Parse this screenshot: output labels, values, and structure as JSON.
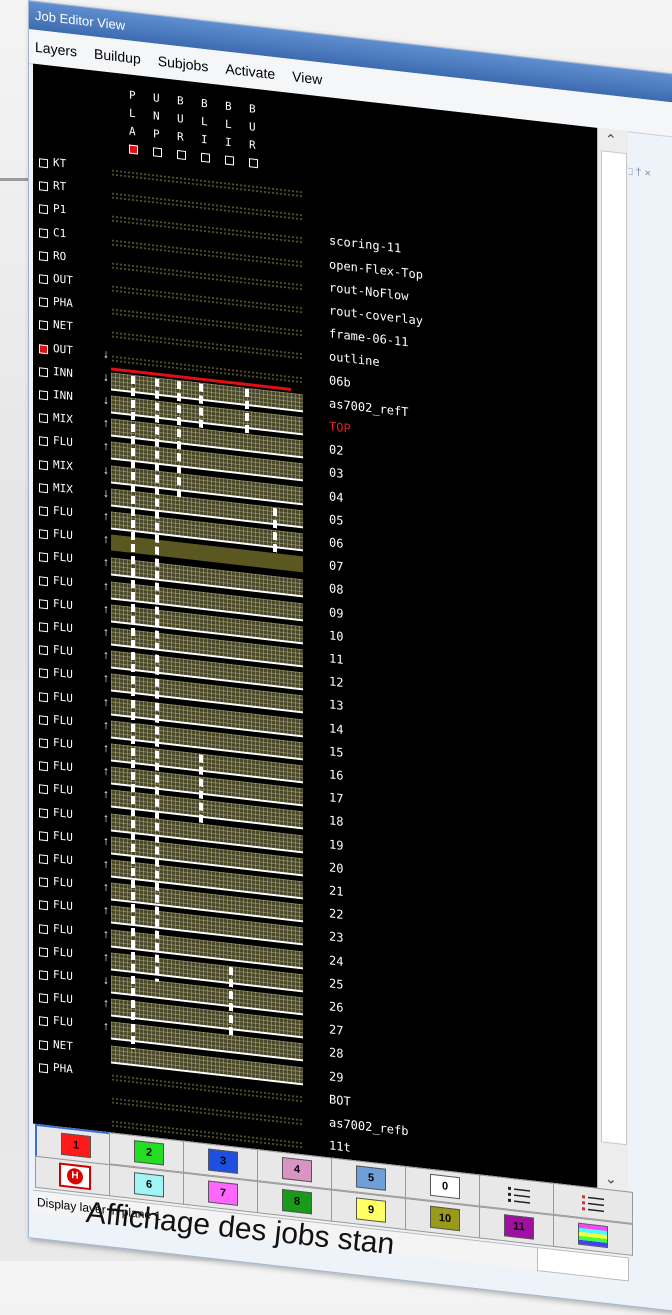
{
  "window": {
    "title": "Job Editor View",
    "controls": "□ † ×"
  },
  "menu": [
    "Layers",
    "Buildup",
    "Subjobs",
    "Activate",
    "View"
  ],
  "header_columns": [
    {
      "letters": [
        "P",
        "L",
        "A"
      ],
      "checked": true
    },
    {
      "letters": [
        "U",
        "N",
        "P"
      ],
      "checked": false
    },
    {
      "letters": [
        "B",
        "U",
        "R"
      ],
      "checked": false
    },
    {
      "letters": [
        "B",
        "L",
        "I"
      ],
      "checked": false
    },
    {
      "letters": [
        "B",
        "L",
        "I"
      ],
      "checked": false
    },
    {
      "letters": [
        "B",
        "U",
        "R"
      ],
      "checked": false
    }
  ],
  "layers": [
    {
      "type": "KT",
      "name": "",
      "checked": false,
      "arrow": "",
      "band": "dots"
    },
    {
      "type": "RT",
      "name": "",
      "checked": false,
      "arrow": "",
      "band": "dots"
    },
    {
      "type": "P1",
      "name": "scoring-11",
      "checked": false,
      "arrow": "",
      "band": "dots"
    },
    {
      "type": "C1",
      "name": "open-Flex-Top",
      "checked": false,
      "arrow": "",
      "band": "dots"
    },
    {
      "type": "RO",
      "name": "rout-NoFlow",
      "checked": false,
      "arrow": "",
      "band": "dots"
    },
    {
      "type": "OUT",
      "name": "rout-coverlay",
      "checked": false,
      "arrow": "",
      "band": "dots"
    },
    {
      "type": "PHA",
      "name": "frame-06-11",
      "checked": false,
      "arrow": "",
      "band": "dots"
    },
    {
      "type": "NET",
      "name": "outline",
      "checked": false,
      "arrow": "",
      "band": "dots"
    },
    {
      "type": "OUT",
      "name": "06b",
      "checked": true,
      "arrow": "↓",
      "band": "dots"
    },
    {
      "type": "INN",
      "name": "as7002_refT",
      "checked": false,
      "arrow": "↓",
      "band": "cu"
    },
    {
      "type": "INN",
      "name": "TOP",
      "checked": false,
      "arrow": "↓",
      "band": "cu",
      "red": true
    },
    {
      "type": "MIX",
      "name": "02",
      "checked": false,
      "arrow": "↑",
      "band": "cu"
    },
    {
      "type": "FLU",
      "name": "03",
      "checked": false,
      "arrow": "↑",
      "band": "cu"
    },
    {
      "type": "MIX",
      "name": "04",
      "checked": false,
      "arrow": "↓",
      "band": "cu"
    },
    {
      "type": "MIX",
      "name": "05",
      "checked": false,
      "arrow": "↓",
      "band": "cu"
    },
    {
      "type": "FLU",
      "name": "06",
      "checked": false,
      "arrow": "↑",
      "band": "cu"
    },
    {
      "type": "FLU",
      "name": "07",
      "checked": false,
      "arrow": "↑",
      "band": "yellow"
    },
    {
      "type": "FLU",
      "name": "08",
      "checked": false,
      "arrow": "↑",
      "band": "cu"
    },
    {
      "type": "FLU",
      "name": "09",
      "checked": false,
      "arrow": "↑",
      "band": "cu"
    },
    {
      "type": "FLU",
      "name": "10",
      "checked": false,
      "arrow": "↑",
      "band": "cu"
    },
    {
      "type": "FLU",
      "name": "11",
      "checked": false,
      "arrow": "↑",
      "band": "cu"
    },
    {
      "type": "FLU",
      "name": "12",
      "checked": false,
      "arrow": "↑",
      "band": "cu"
    },
    {
      "type": "FLU",
      "name": "13",
      "checked": false,
      "arrow": "↑",
      "band": "cu"
    },
    {
      "type": "FLU",
      "name": "14",
      "checked": false,
      "arrow": "↑",
      "band": "cu"
    },
    {
      "type": "FLU",
      "name": "15",
      "checked": false,
      "arrow": "↑",
      "band": "cu"
    },
    {
      "type": "FLU",
      "name": "16",
      "checked": false,
      "arrow": "↑",
      "band": "cu"
    },
    {
      "type": "FLU",
      "name": "17",
      "checked": false,
      "arrow": "↑",
      "band": "cu"
    },
    {
      "type": "FLU",
      "name": "18",
      "checked": false,
      "arrow": "↑",
      "band": "cu"
    },
    {
      "type": "FLU",
      "name": "19",
      "checked": false,
      "arrow": "↑",
      "band": "cu"
    },
    {
      "type": "FLU",
      "name": "20",
      "checked": false,
      "arrow": "↑",
      "band": "cu"
    },
    {
      "type": "FLU",
      "name": "21",
      "checked": false,
      "arrow": "↑",
      "band": "cu"
    },
    {
      "type": "FLU",
      "name": "22",
      "checked": false,
      "arrow": "↑",
      "band": "cu"
    },
    {
      "type": "FLU",
      "name": "23",
      "checked": false,
      "arrow": "↑",
      "band": "cu"
    },
    {
      "type": "FLU",
      "name": "24",
      "checked": false,
      "arrow": "↑",
      "band": "cu"
    },
    {
      "type": "FLU",
      "name": "25",
      "checked": false,
      "arrow": "↑",
      "band": "cu"
    },
    {
      "type": "FLU",
      "name": "26",
      "checked": false,
      "arrow": "↓",
      "band": "cu"
    },
    {
      "type": "FLU",
      "name": "27",
      "checked": false,
      "arrow": "↑",
      "band": "cu"
    },
    {
      "type": "FLU",
      "name": "28",
      "checked": false,
      "arrow": "↑",
      "band": "cu"
    },
    {
      "type": "NET",
      "name": "29",
      "checked": false,
      "arrow": "",
      "band": "cu"
    },
    {
      "type": "PHA",
      "name": "BOT",
      "checked": false,
      "arrow": "",
      "band": "dots"
    },
    {
      "type": "",
      "name": "as7002_refb",
      "checked": false,
      "arrow": "",
      "band": "dots"
    },
    {
      "type": "",
      "name": "11t",
      "checked": false,
      "arrow": "",
      "band": "dots"
    }
  ],
  "palette_top": [
    {
      "label": "1",
      "color": "#ff1a1a",
      "selected": true
    },
    {
      "label": "2",
      "color": "#22dd22"
    },
    {
      "label": "3",
      "color": "#1f4fe0"
    },
    {
      "label": "4",
      "color": "#d994c4"
    },
    {
      "label": "5",
      "color": "#6f9fd8"
    },
    {
      "label": "0",
      "color": "#ffffff"
    },
    {
      "label": "",
      "color": "list-icon"
    },
    {
      "label": "",
      "color": "colored-list-icon"
    }
  ],
  "palette_bottom": [
    {
      "label": "",
      "color": "h-stop-icon"
    },
    {
      "label": "6",
      "color": "#9ff5f5"
    },
    {
      "label": "7",
      "color": "#ff66ff"
    },
    {
      "label": "8",
      "color": "#1a9a1a"
    },
    {
      "label": "9",
      "color": "#ffff66"
    },
    {
      "label": "10",
      "color": "#9a9a1a"
    },
    {
      "label": "11",
      "color": "#a010a0"
    },
    {
      "label": "",
      "color": "rainbow-icon"
    }
  ],
  "status": {
    "text": "Display layer in plane 1"
  },
  "caption": "Affichage des jobs stan"
}
